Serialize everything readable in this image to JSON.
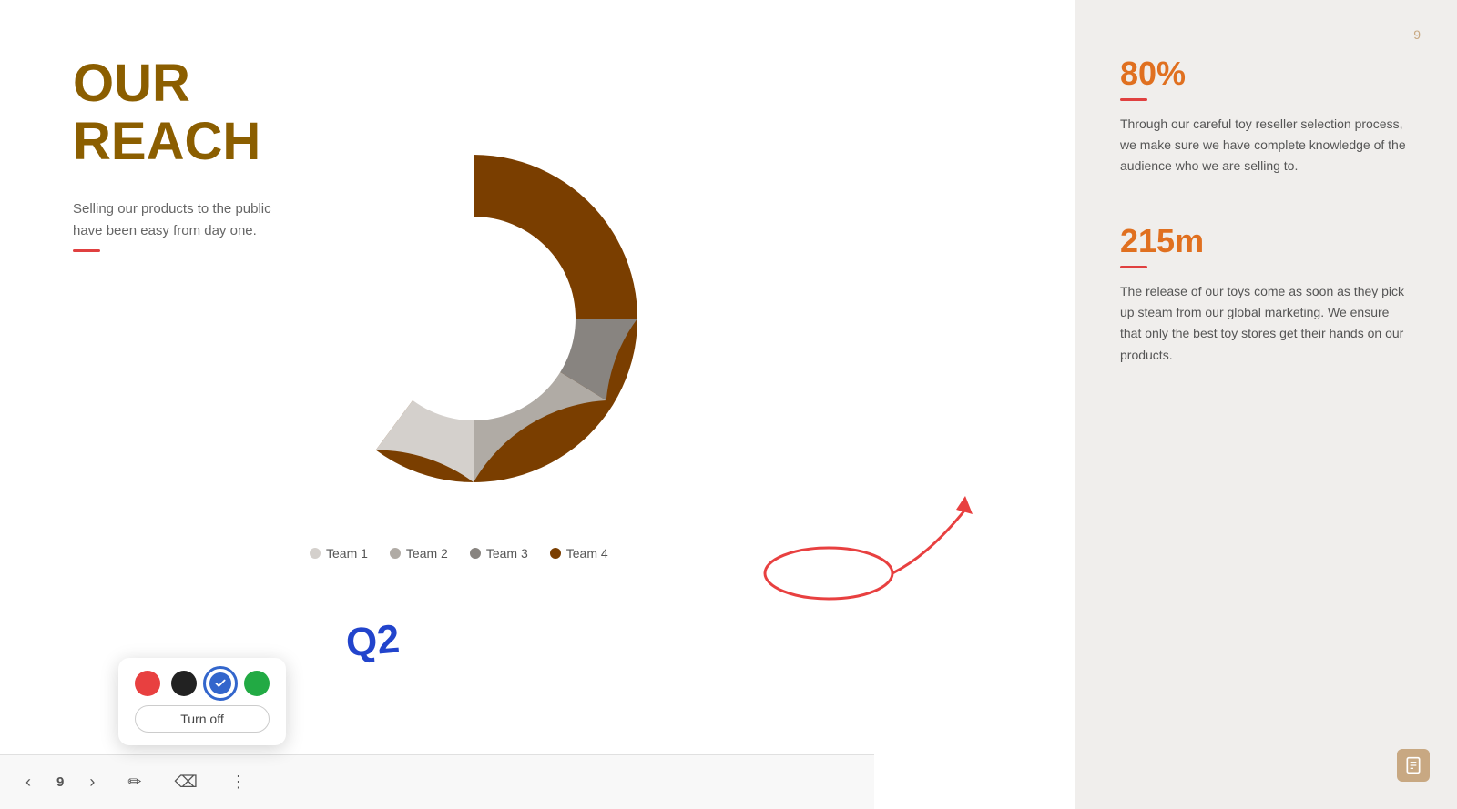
{
  "slide": {
    "title_line1": "OUR",
    "title_line2": "REACH",
    "description": "Selling our products to the public have been easy from day one.",
    "q2_label": "Q2"
  },
  "chart": {
    "segments": [
      {
        "team": "Team 1",
        "color": "#d4d0cc",
        "pct": 15,
        "startAngle": -90
      },
      {
        "team": "Team 2",
        "color": "#b0aba5",
        "pct": 15,
        "startAngle": -36
      },
      {
        "team": "Team 3",
        "color": "#888480",
        "pct": 10,
        "startAngle": 18
      },
      {
        "team": "Team 4",
        "color": "#7a3e00",
        "pct": 60,
        "startAngle": 54
      }
    ],
    "legend": [
      {
        "label": "Team 1",
        "color": "#d4d0cc"
      },
      {
        "label": "Team 2",
        "color": "#b0aba5"
      },
      {
        "label": "Team 3",
        "color": "#888480"
      },
      {
        "label": "Team 4",
        "color": "#7a3e00"
      }
    ]
  },
  "stats": [
    {
      "value": "80%",
      "description": "Through our careful toy reseller selection process, we make sure we have complete knowledge of the audience who we are selling to."
    },
    {
      "value": "215m",
      "description": "The release of our toys come as soon as they pick up steam from our global marketing. We ensure that only the best toy stores get their hands on our products."
    }
  ],
  "toolbar": {
    "prev_label": "‹",
    "page_number": "9",
    "next_label": "›",
    "pen_icon": "✏",
    "eraser_icon": "⌫",
    "more_icon": "⋮"
  },
  "color_picker": {
    "colors": [
      {
        "name": "red",
        "hex": "#e84040"
      },
      {
        "name": "black",
        "hex": "#222222"
      },
      {
        "name": "blue",
        "hex": "#3366cc"
      },
      {
        "name": "green",
        "hex": "#22aa44"
      }
    ],
    "turn_off_label": "Turn off",
    "selected_color": "blue"
  },
  "page": {
    "number": "9"
  }
}
